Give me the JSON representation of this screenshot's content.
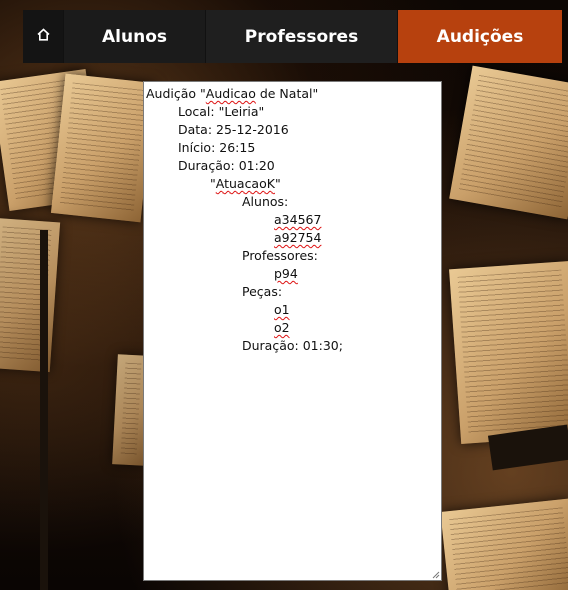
{
  "nav": {
    "home_icon": "home-icon",
    "items": [
      {
        "label": "Alunos"
      },
      {
        "label": "Professores"
      },
      {
        "label": "Audições",
        "active": true
      }
    ],
    "active_color": "#b7410e"
  },
  "editor": {
    "line1_prefix": "Audição \"",
    "line1_name_a": "Audicao",
    "line1_name_b": " de Natal\"",
    "local": "Local: \"Leiria\"",
    "data": "Data: 25-12-2016",
    "inicio": "Início: 26:15",
    "duracao": "Duração: 01:20",
    "atuacao_q1": "\"",
    "atuacao_name": "AtuacaoK",
    "atuacao_q2": "\"",
    "alunos_label": "Alunos:",
    "alunos": [
      "a34567",
      "a92754"
    ],
    "professores_label": "Professores:",
    "professores": [
      "p94"
    ],
    "pecas_label": "Peças:",
    "pecas": [
      "o1",
      "o2"
    ],
    "atuacao_duracao": "Duração: 01:30;"
  }
}
